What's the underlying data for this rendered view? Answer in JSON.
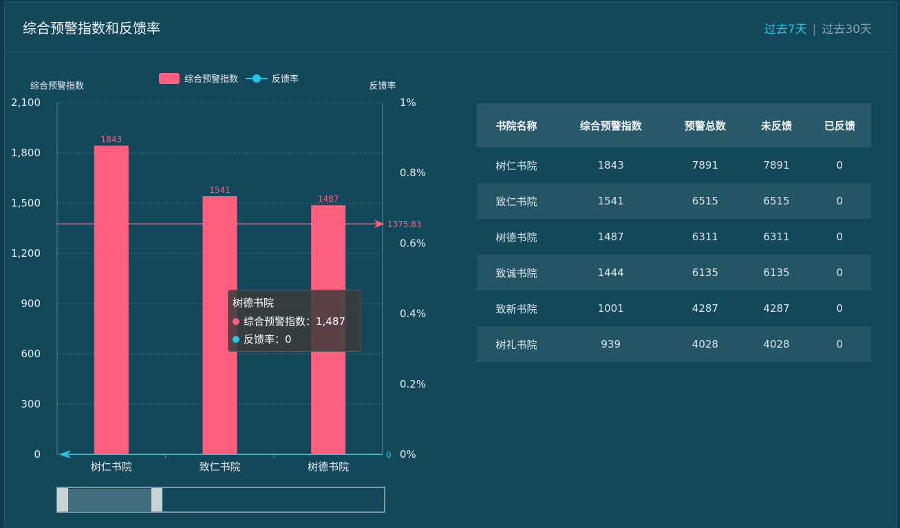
{
  "header": {
    "title": "综合预警指数和反馈率",
    "period_7": "过去7天",
    "period_sep": "|",
    "period_30": "过去30天"
  },
  "chart_data": {
    "type": "bar",
    "categories": [
      "树仁书院",
      "致仁书院",
      "树德书院"
    ],
    "series": [
      {
        "name": "综合预警指数",
        "type": "bar",
        "values": [
          1843,
          1541,
          1487
        ],
        "color": "#ff5f7e"
      },
      {
        "name": "反馈率",
        "type": "line",
        "values": [
          0,
          0,
          0
        ],
        "color": "#1ec8e6"
      }
    ],
    "ylabel_left": "综合预警指数",
    "ylabel_right": "反馈率",
    "ylim_left": [
      0,
      2100
    ],
    "yticks_left": [
      "0",
      "300",
      "600",
      "900",
      "1,200",
      "1,500",
      "1,800",
      "2,100"
    ],
    "ylim_right": [
      0,
      1
    ],
    "yticks_right": [
      "0%",
      "0.2%",
      "0.4%",
      "0.6%",
      "0.8%",
      "1%"
    ],
    "mark_line": {
      "value": 1375.83,
      "label": "1375.83"
    },
    "feedback_end_label": "0",
    "legend_position": "top",
    "grid": true
  },
  "tooltip": {
    "title": "树德书院",
    "row1": "综合预警指数：1,487",
    "row2": "反馈率：0"
  },
  "table": {
    "headers": [
      "书院名称",
      "综合预警指数",
      "预警总数",
      "未反馈",
      "已反馈"
    ],
    "rows": [
      [
        "树仁书院",
        "1843",
        "7891",
        "7891",
        "0"
      ],
      [
        "致仁书院",
        "1541",
        "6515",
        "6515",
        "0"
      ],
      [
        "树德书院",
        "1487",
        "6311",
        "6311",
        "0"
      ],
      [
        "致诚书院",
        "1444",
        "6135",
        "6135",
        "0"
      ],
      [
        "致新书院",
        "1001",
        "4287",
        "4287",
        "0"
      ],
      [
        "树礼书院",
        "939",
        "4028",
        "4028",
        "0"
      ]
    ]
  },
  "colors": {
    "accent": "#1ec8e6",
    "bar": "#ff5f7e",
    "background": "#13475a"
  }
}
